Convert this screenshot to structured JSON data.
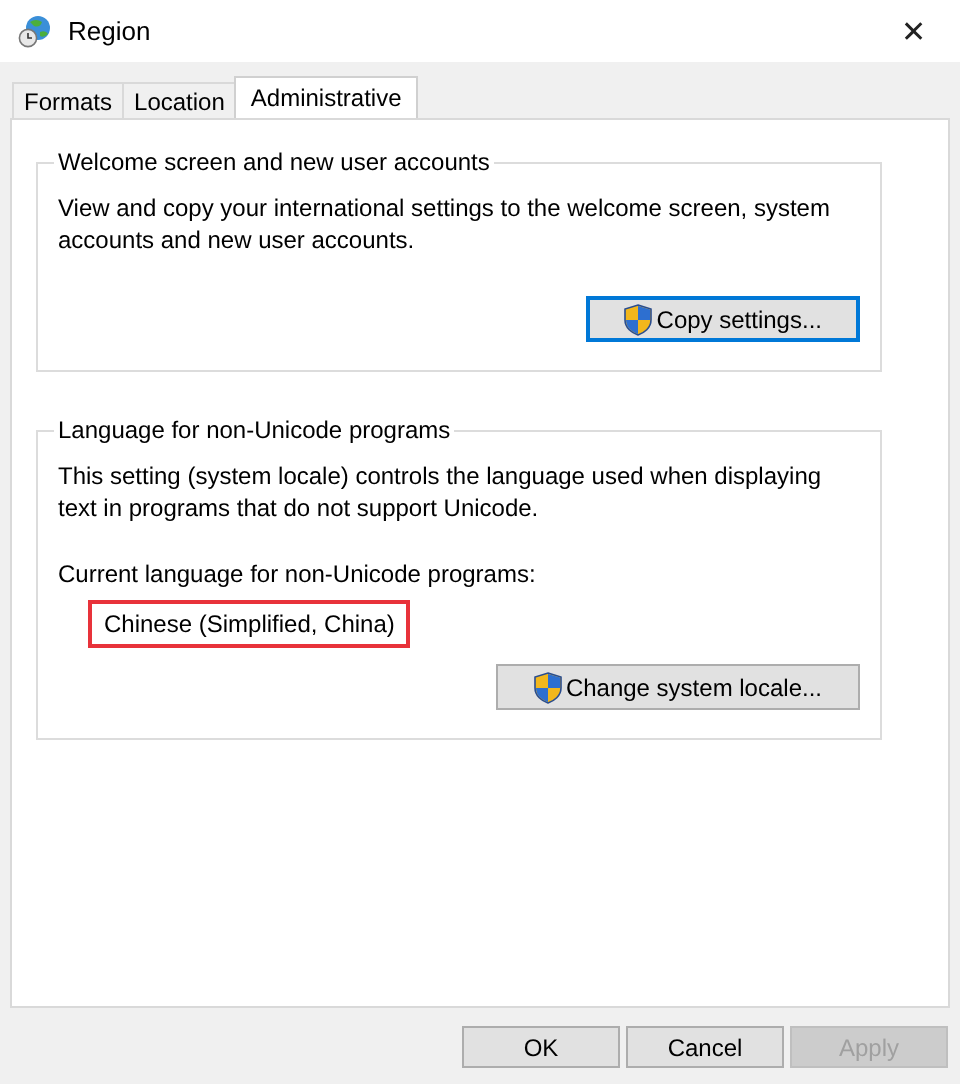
{
  "window": {
    "title": "Region",
    "close": "✕"
  },
  "tabs": [
    {
      "label": "Formats",
      "selected": false
    },
    {
      "label": "Location",
      "selected": false
    },
    {
      "label": "Administrative",
      "selected": true
    }
  ],
  "groups": [
    {
      "title": "Welcome screen and new user accounts",
      "description": "View and copy your international settings to the welcome screen, system accounts and new user accounts.",
      "button": {
        "label": "Copy settings...",
        "shield": true,
        "focused": true
      }
    },
    {
      "title": "Language for non-Unicode programs",
      "description": "This setting (system locale) controls the language used when displaying text in programs that do not support Unicode.",
      "current_label": "Current language for non-Unicode programs:",
      "current_value": {
        "text": "Chinese (Simplified, China)",
        "highlighted": true
      },
      "button": {
        "label": "Change system locale...",
        "shield": true,
        "focused": false
      }
    }
  ],
  "buttons": [
    {
      "label": "OK",
      "disabled": false
    },
    {
      "label": "Cancel",
      "disabled": false
    },
    {
      "label": "Apply",
      "disabled": true
    }
  ]
}
